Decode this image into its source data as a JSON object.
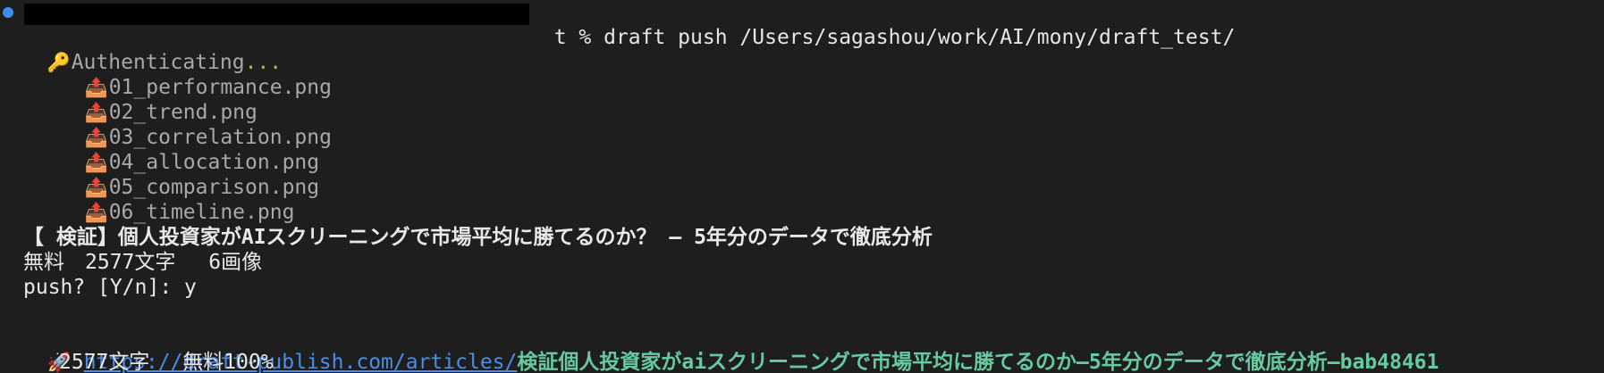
{
  "terminal": {
    "prompt_tail": "t % ",
    "command": "draft push /Users/sagashou/work/AI/mony/draft_test/",
    "auth_icon": "key-icon",
    "auth_label": "Authenticating",
    "auth_dots": "...",
    "upload_icon": "outbox-tray-icon",
    "files": [
      "01_performance.png",
      "02_trend.png",
      "03_correlation.png",
      "04_allocation.png",
      "05_comparison.png",
      "06_timeline.png"
    ],
    "article_title": "【 検証】個人投資家がAIスクリーニングで市場平均に勝てるのか？ – 5年分のデータで徹底分析",
    "meta_line": "無料　2577文字　 6画像",
    "confirm_prompt": "push? [Y/n]: y",
    "rocket_icon": "rocket-icon",
    "url_base": "https://draft-publish.com/articles/",
    "url_slug": "検証個人投資家がaiスクリーニングで市場平均に勝てるのか–5年分のデータで徹底分析–bab48461",
    "result_line": "2577文字　 無料100%"
  },
  "colors": {
    "background": "#1e1e1e",
    "link": "#4a8de8",
    "slug": "#66c9a0",
    "bullet": "#3b8eea"
  }
}
